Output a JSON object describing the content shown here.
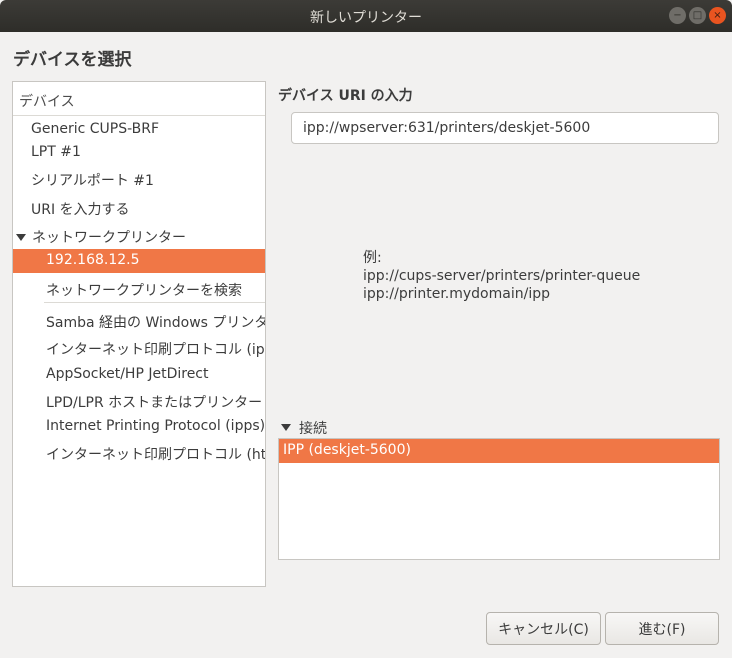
{
  "window": {
    "title": "新しいプリンター",
    "minimize_glyph": "−",
    "maximize_glyph": "□",
    "close_glyph": "×"
  },
  "section_title": "デバイスを選択",
  "device_list": {
    "header": "デバイス",
    "items": [
      {
        "label": "Generic CUPS-BRF"
      },
      {
        "label": "LPT #1"
      },
      {
        "label": "シリアルポート #1"
      },
      {
        "label": "URI を入力する"
      },
      {
        "label": "ネットワークプリンター"
      },
      {
        "label": "192.168.12.5"
      },
      {
        "label": "ネットワークプリンターを検索"
      },
      {
        "label": "Samba 経由の Windows プリンター"
      },
      {
        "label": "インターネット印刷プロトコル (ipp)"
      },
      {
        "label": "AppSocket/HP JetDirect"
      },
      {
        "label": "LPD/LPR ホストまたはプリンター"
      },
      {
        "label": "Internet Printing Protocol (ipps)"
      },
      {
        "label": "インターネット印刷プロトコル (https)"
      }
    ]
  },
  "uri": {
    "label": "デバイス URI の入力",
    "value": "ipp://wpserver:631/printers/deskjet-5600"
  },
  "example": {
    "heading": "例:",
    "line1": "ipp://cups-server/printers/printer-queue",
    "line2": "ipp://printer.mydomain/ipp"
  },
  "connection": {
    "header": "接続",
    "items": [
      {
        "label": "IPP (deskjet-5600)"
      }
    ]
  },
  "buttons": {
    "cancel": "キャンセル(C)",
    "next": "進む(F)"
  },
  "colors": {
    "selection": "#f07746",
    "titlebar": "#3c3b37",
    "close_button": "#e95420"
  }
}
